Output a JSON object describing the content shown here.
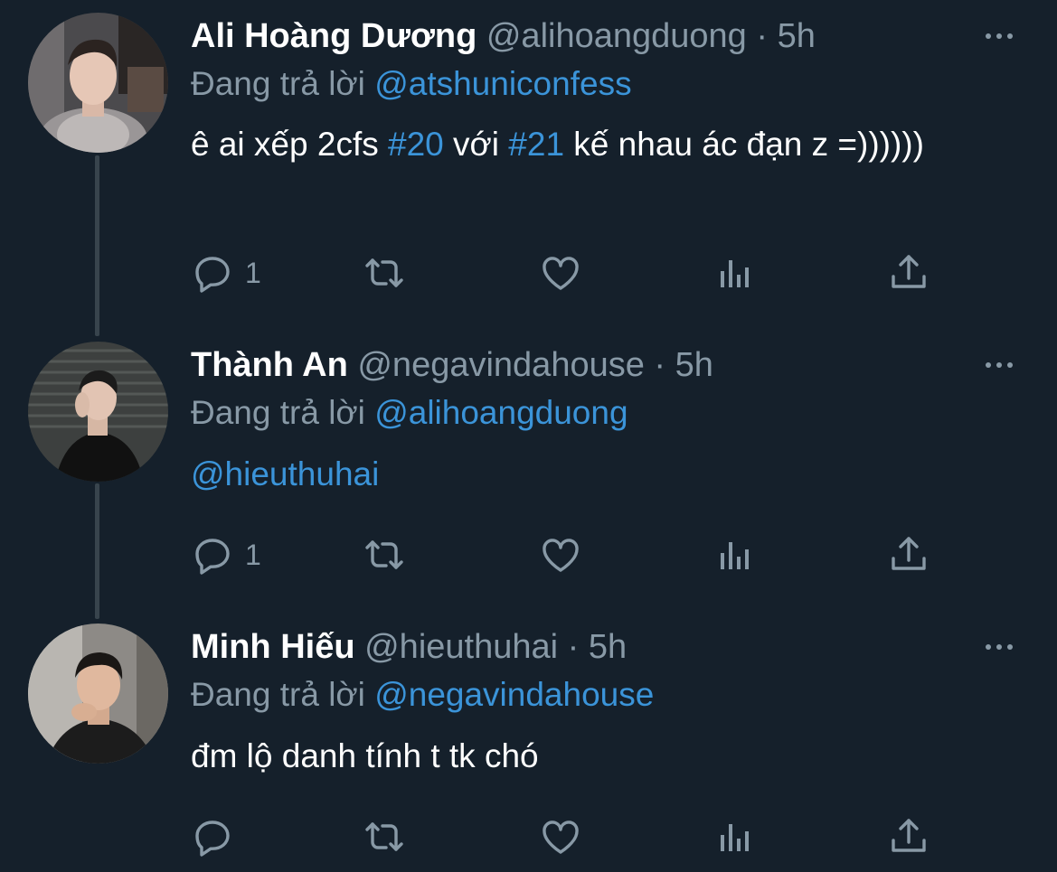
{
  "tweets": [
    {
      "name": "Ali Hoàng Dương",
      "handle": "@alihoangduong",
      "dot": "·",
      "time": "5h",
      "replying_prefix": "Đang trả lời",
      "replying_to": "@atshuniconfess",
      "text_parts": [
        "ê ai xếp 2cfs ",
        "#20",
        " với ",
        "#21",
        " kế nhau ác đạn z =))))))"
      ],
      "reply_count": "1"
    },
    {
      "name": "Thành An",
      "handle": "@negavindahouse",
      "dot": "·",
      "time": "5h",
      "replying_prefix": "Đang trả lời",
      "replying_to": "@alihoangduong",
      "mention": "@hieuthuhai",
      "reply_count": "1"
    },
    {
      "name": "Minh Hiếu",
      "handle": "@hieuthuhai",
      "dot": "·",
      "time": "5h",
      "replying_prefix": "Đang trả lời",
      "replying_to": "@negavindahouse",
      "text": "đm lộ danh tính t tk chó",
      "reply_count": ""
    }
  ],
  "icons": {
    "reply": "reply-icon",
    "retweet": "retweet-icon",
    "like": "heart-icon",
    "analytics": "analytics-icon",
    "share": "share-icon",
    "more": "more-icon"
  },
  "colors": {
    "background": "#15202b",
    "secondary_text": "#8899a6",
    "link": "#3b94d9",
    "thread_line": "#38444d"
  }
}
